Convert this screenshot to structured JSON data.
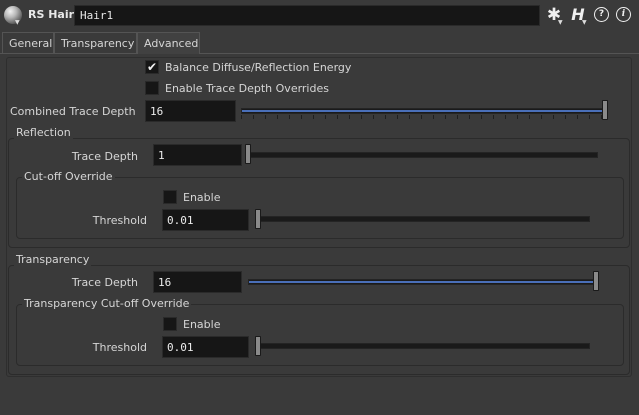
{
  "header": {
    "node_type": "RS Hair",
    "node_name": "Hair1"
  },
  "tabs": [
    "General",
    "Transparency",
    "Advanced"
  ],
  "active_tab": "Advanced",
  "balance": {
    "label": "Balance Diffuse/Reflection Energy",
    "checked": true
  },
  "enable_overrides": {
    "label": "Enable Trace Depth Overrides",
    "checked": false
  },
  "combined": {
    "label": "Combined Trace Depth",
    "value": "16",
    "fraction": 1.0
  },
  "reflection": {
    "title": "Reflection",
    "trace_label": "Trace Depth",
    "trace_value": "1",
    "trace_fraction": 0.0,
    "cutoff": {
      "title": "Cut-off Override",
      "enable_label": "Enable",
      "enabled": false,
      "threshold_label": "Threshold",
      "threshold_value": "0.01",
      "threshold_fraction": 0.0
    }
  },
  "transparency": {
    "title": "Transparency",
    "trace_label": "Trace Depth",
    "trace_value": "16",
    "trace_fraction": 1.0,
    "cutoff": {
      "title": "Transparency Cut-off Override",
      "enable_label": "Enable",
      "enabled": false,
      "threshold_label": "Threshold",
      "threshold_value": "0.01",
      "threshold_fraction": 0.0
    }
  },
  "icons": {
    "node": "redshift-node-icon",
    "gear": "gear-icon",
    "houdini": "houdini-icon",
    "help": "help-icon",
    "info": "info-icon"
  },
  "colors": {
    "background": "#3a3a3a",
    "field": "#161616",
    "slider_fill": "#4a6fb8",
    "text": "#d6d6d6"
  }
}
